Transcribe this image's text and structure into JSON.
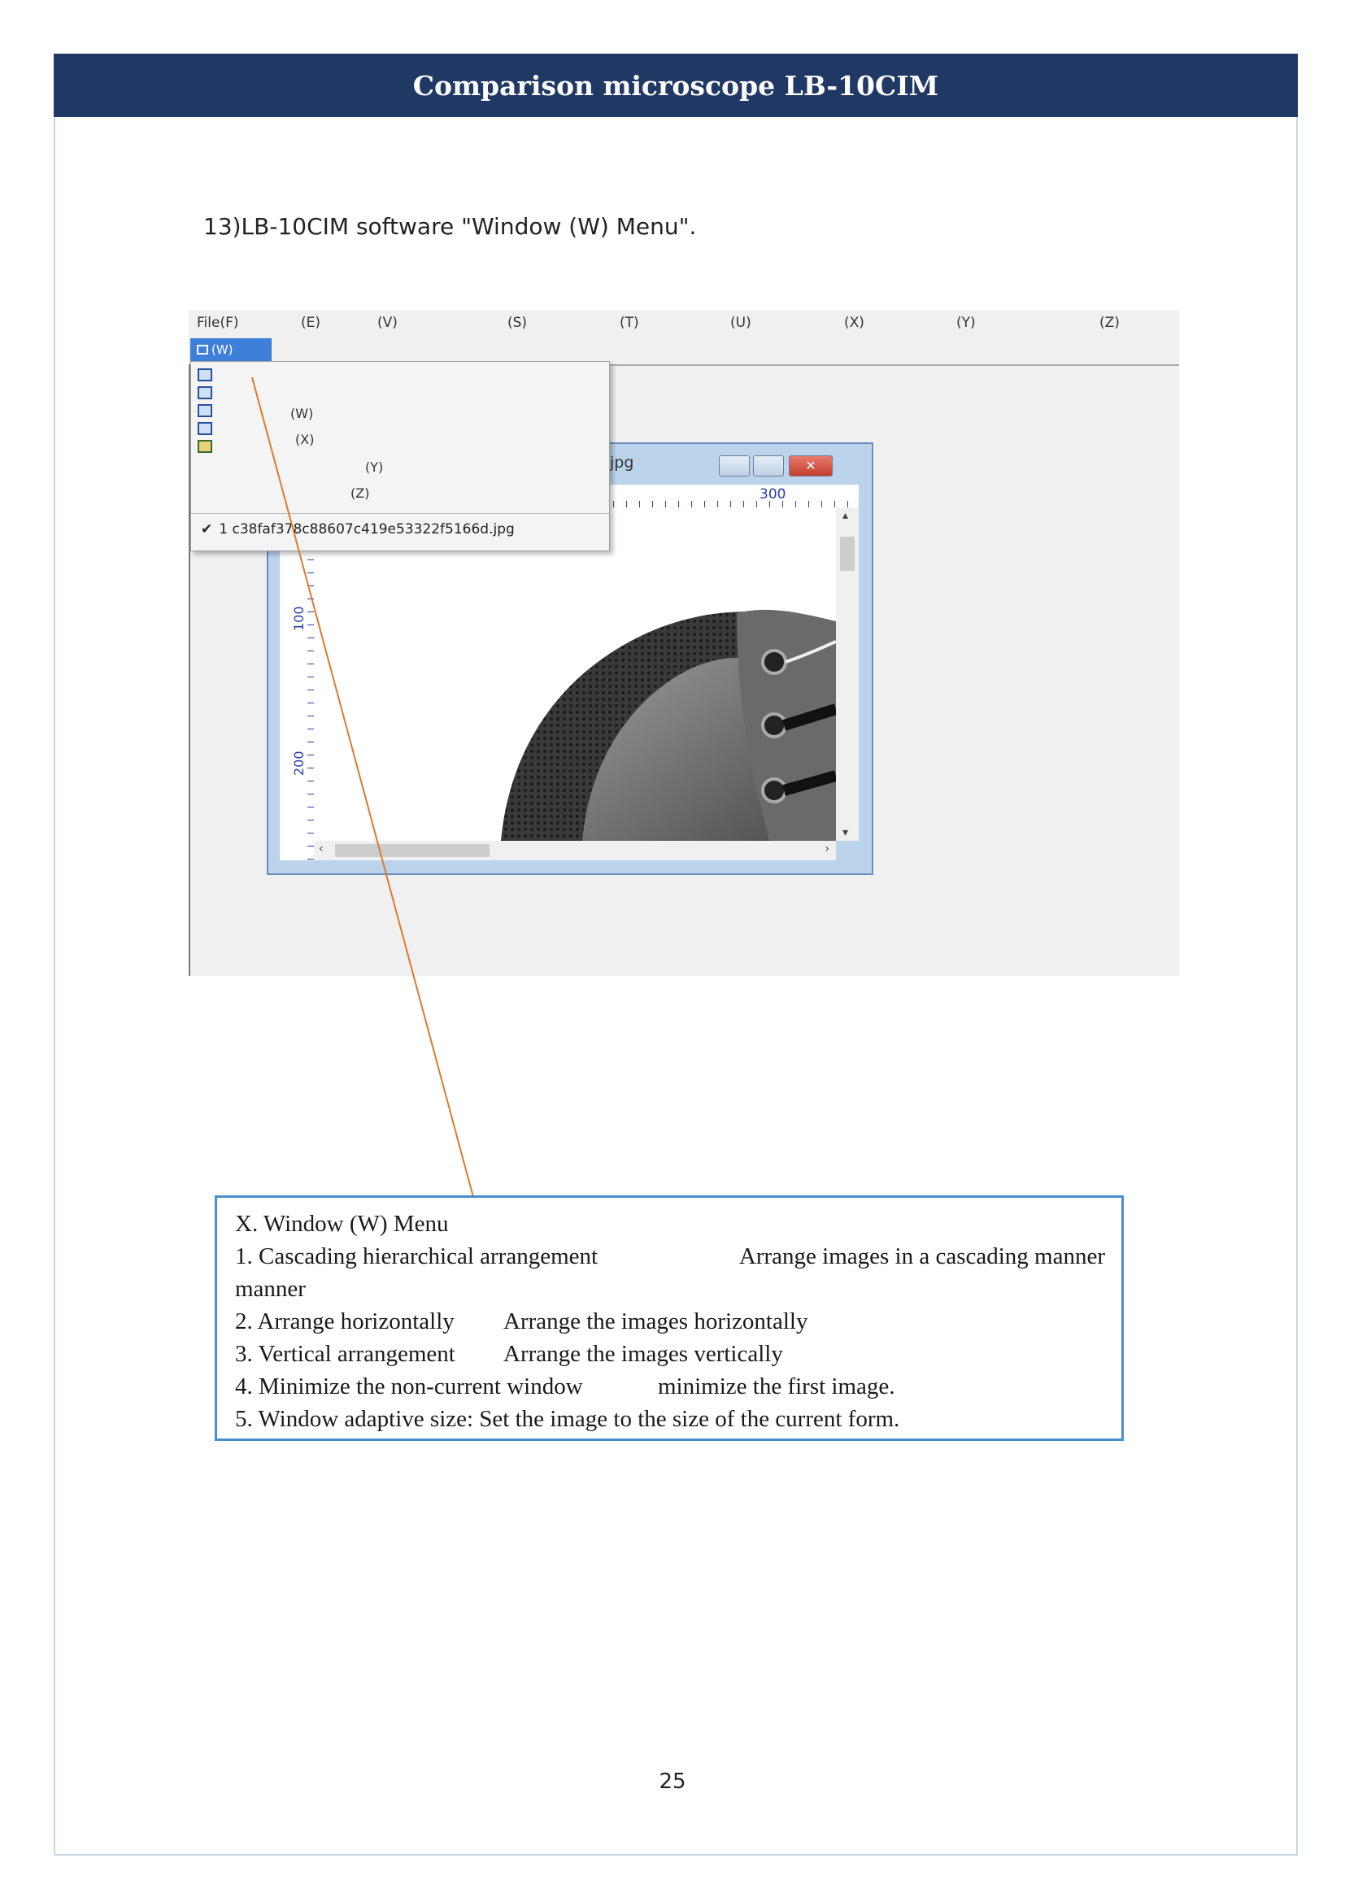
{
  "header": {
    "title": "Comparison microscope LB-10CIM"
  },
  "section": {
    "heading": "13)LB-10CIM software \"Window (W) Menu\"."
  },
  "screenshot": {
    "menubar": [
      "File(F)",
      "(E)",
      "(V)",
      "(S)",
      "(T)",
      "(U)",
      "(X)",
      "(Y)",
      "(Z)"
    ],
    "window_menu_label": "(W)",
    "dropdown_items": [
      {
        "label": "(W)",
        "icon": "tile-horizontal-icon"
      },
      {
        "label": "(X)",
        "icon": "tile-vertical-icon"
      },
      {
        "label": "(Y)",
        "icon": "minimize-windows-icon"
      },
      {
        "label": "(Z)",
        "icon": "image-fit-icon"
      }
    ],
    "cascade_icon": "cascade-windows-icon",
    "open_file": "1 c38faf378c88607c419e53322f5166d.jpg",
    "image_window": {
      "title": "jpg",
      "ruler_top_label": "300",
      "ruler_left_labels": [
        "100",
        "200"
      ]
    }
  },
  "callout": {
    "title": "X. Window (W) Menu",
    "items": [
      {
        "name": "1. Cascading hierarchical arrangement",
        "desc": "Arrange images in a cascading manner"
      },
      {
        "name": "2. Arrange horizontally",
        "desc": "Arrange the images horizontally"
      },
      {
        "name": "3. Vertical arrangement",
        "desc": "Arrange the images vertically"
      },
      {
        "name": "4. Minimize the non-current window",
        "desc": "minimize the first image."
      },
      {
        "name": "5. Window adaptive size: Set the image to the size of the current form.",
        "desc": ""
      }
    ]
  },
  "footer": {
    "page_number": "25"
  },
  "colors": {
    "header_bg": "#1f3864",
    "callout_border": "#4a8fd0",
    "pointer_line": "#e07a2a"
  }
}
